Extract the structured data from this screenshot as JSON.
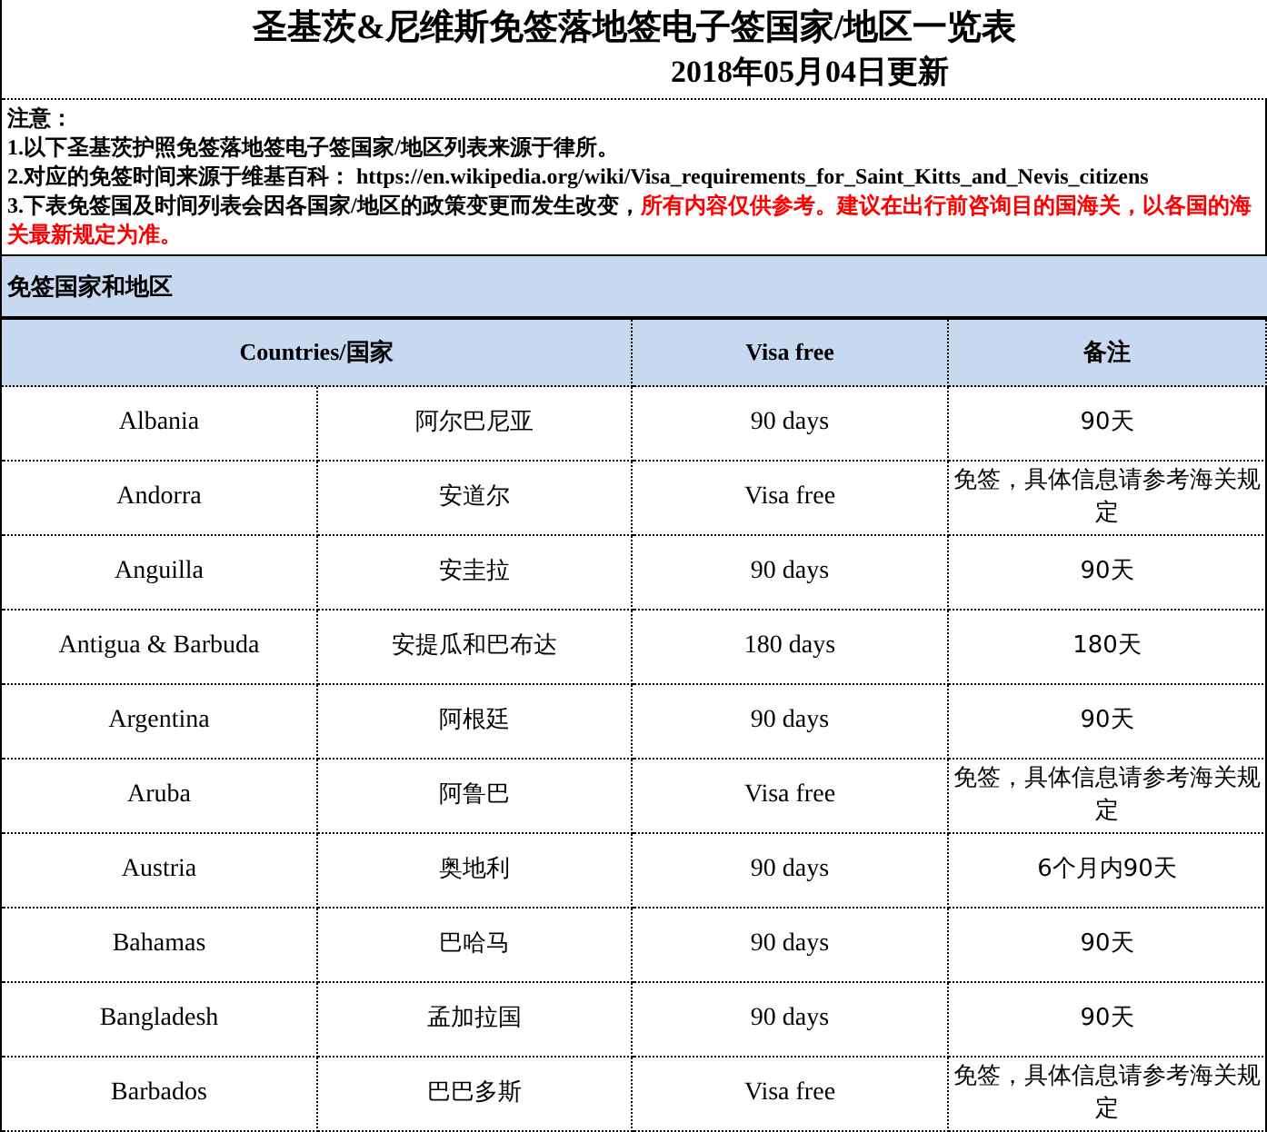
{
  "title": "圣基茨&尼维斯免签落地签电子签国家/地区一览表",
  "subtitle": "2018年05月04日更新",
  "notes": [
    {
      "parts": [
        {
          "text": "注意：",
          "highlight": false
        }
      ]
    },
    {
      "parts": [
        {
          "text": "1.以下圣基茨护照免签落地签电子签国家/地区列表来源于律所。",
          "highlight": false
        }
      ]
    },
    {
      "parts": [
        {
          "text": "2.对应的免签时间来源于维基百科：  https://en.wikipedia.org/wiki/Visa_requirements_for_Saint_Kitts_and_Nevis_citizens",
          "highlight": false
        }
      ]
    },
    {
      "parts": [
        {
          "text": "3.下表免签国及时间列表会因各国家/地区的政策变更而发生改变，",
          "highlight": false
        },
        {
          "text": "所有内容仅供参考。建议在出行前咨询目的国海关，以各国的海关最新规定为准。",
          "highlight": true
        }
      ]
    }
  ],
  "section": "免签国家和地区",
  "table": {
    "columns": [
      "Countries/国家",
      "Visa free",
      "备注"
    ],
    "rows": [
      {
        "country_en": "Albania",
        "country_zh": "阿尔巴尼亚",
        "visa_free": "90 days",
        "remark": "90天"
      },
      {
        "country_en": "Andorra",
        "country_zh": "安道尔",
        "visa_free": "Visa free",
        "remark": "免签，具体信息请参考海关规定"
      },
      {
        "country_en": "Anguilla",
        "country_zh": "安圭拉",
        "visa_free": "90 days",
        "remark": "90天"
      },
      {
        "country_en": "Antigua & Barbuda",
        "country_zh": "安提瓜和巴布达",
        "visa_free": "180 days",
        "remark": "180天"
      },
      {
        "country_en": "Argentina",
        "country_zh": "阿根廷",
        "visa_free": "90 days",
        "remark": "90天"
      },
      {
        "country_en": "Aruba",
        "country_zh": "阿鲁巴",
        "visa_free": "Visa free",
        "remark": "免签，具体信息请参考海关规定"
      },
      {
        "country_en": "Austria",
        "country_zh": "奥地利",
        "visa_free": "90 days",
        "remark": "6个月内90天"
      },
      {
        "country_en": "Bahamas",
        "country_zh": "巴哈马",
        "visa_free": "90 days",
        "remark": "90天"
      },
      {
        "country_en": "Bangladesh",
        "country_zh": "孟加拉国",
        "visa_free": "90 days",
        "remark": "90天"
      },
      {
        "country_en": "Barbados",
        "country_zh": "巴巴多斯",
        "visa_free": "Visa free",
        "remark": "免签，具体信息请参考海关规定"
      }
    ]
  }
}
